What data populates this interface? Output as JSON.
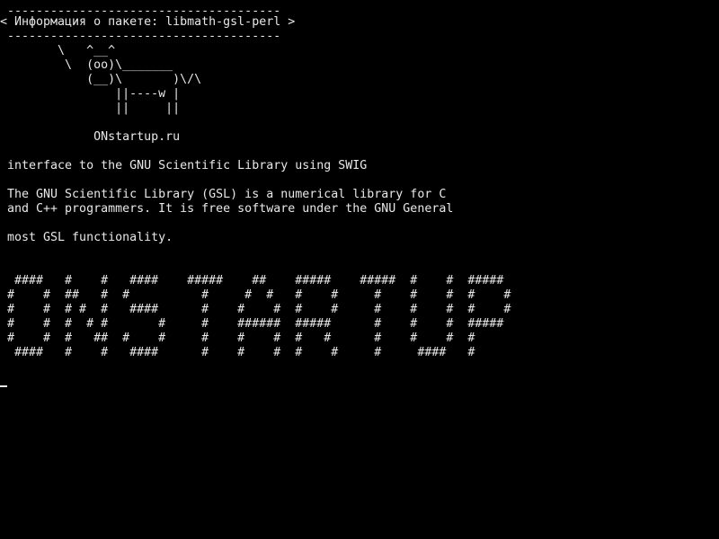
{
  "speech_bubble": {
    "top_border": " --------------------------------------",
    "text": "< Информация о пакете: libmath-gsl-perl >",
    "bottom_border": " --------------------------------------"
  },
  "cow": {
    "line1": "        \\   ^__^",
    "line2": "         \\  (oo)\\_______",
    "line3": "            (__)\\       )\\/\\",
    "line4": "                ||----w |",
    "line5": "                ||     ||"
  },
  "site_label": "             ONstartup.ru",
  "description": {
    "summary": " interface to the GNU Scientific Library using SWIG",
    "para1_line1": " The GNU Scientific Library (GSL) is a numerical library for C",
    "para1_line2": " and C++ programmers. It is free software under the GNU General",
    "para2_line1": " most GSL functionality."
  },
  "banner": {
    "row1": "  ####   #    #   ####    #####    ##    #####    #####  #    #  #####",
    "row2": " #    #  ##   #  #          #     #  #   #    #     #    #    #  #    #",
    "row3": " #    #  # #  #   ####      #    #    #  #    #     #    #    #  #    #",
    "row4": " #    #  #  # #       #     #    ######  #####      #    #    #  #####",
    "row5": " #    #  #   ##  #    #     #    #    #  #   #      #    #    #  #",
    "row6": "  ####   #    #   ####      #    #    #  #    #     #     ####   #"
  },
  "colors": {
    "background": "#000000",
    "foreground": "#e8e8e8"
  }
}
